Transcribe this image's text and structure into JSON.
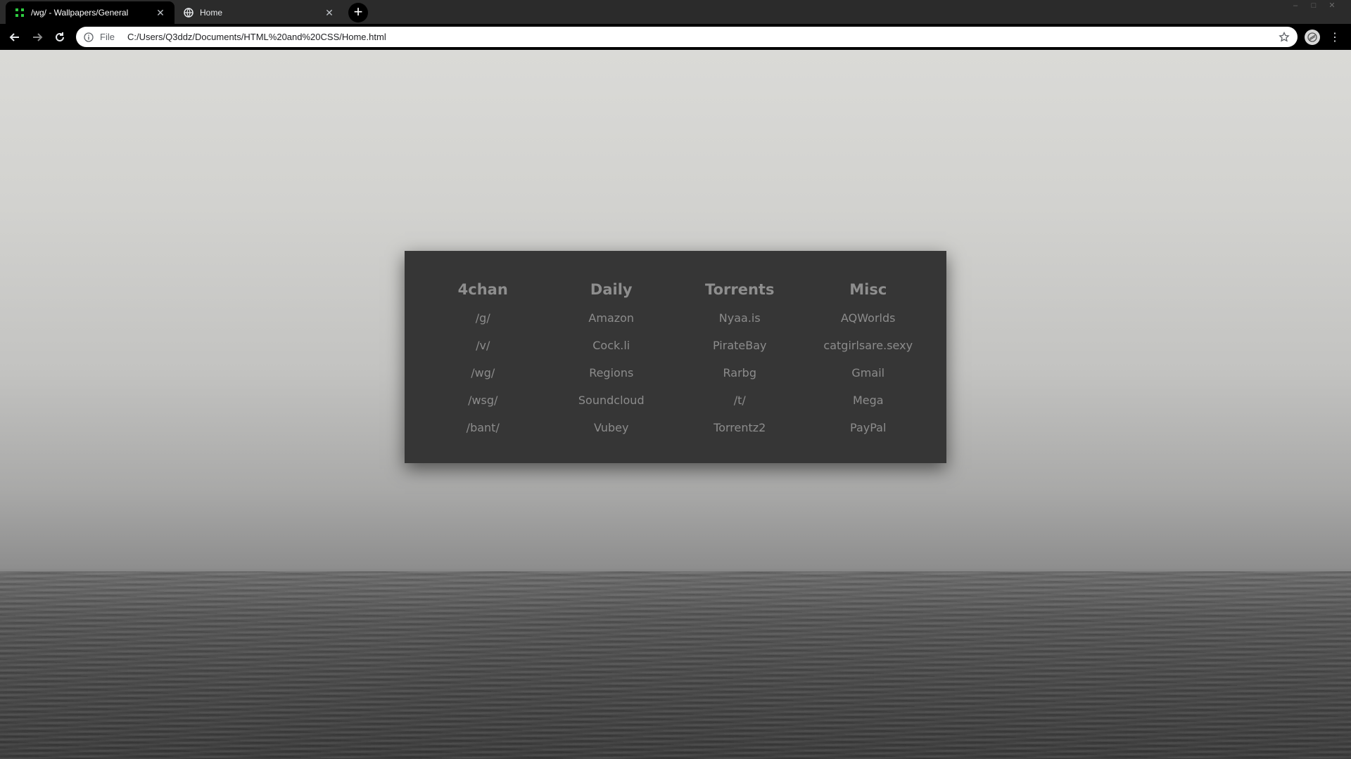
{
  "browser": {
    "tabs": [
      {
        "title": "/wg/ - Wallpapers/General",
        "active": true
      },
      {
        "title": "Home",
        "active": false
      }
    ],
    "new_tab": "+",
    "window_controls": [
      "–",
      "□",
      "✕"
    ],
    "address": {
      "scheme": "File",
      "url": "C:/Users/Q3ddz/Documents/HTML%20and%20CSS/Home.html"
    }
  },
  "panel": {
    "columns": [
      {
        "title": "4chan",
        "links": [
          "/g/",
          "/v/",
          "/wg/",
          "/wsg/",
          "/bant/"
        ]
      },
      {
        "title": "Daily",
        "links": [
          "Amazon",
          "Cock.li",
          "Regions",
          "Soundcloud",
          "Vubey"
        ]
      },
      {
        "title": "Torrents",
        "links": [
          "Nyaa.is",
          "PirateBay",
          "Rarbg",
          "/t/",
          "Torrentz2"
        ]
      },
      {
        "title": "Misc",
        "links": [
          "AQWorlds",
          "catgirlsare.sexy",
          "Gmail",
          "Mega",
          "PayPal"
        ]
      }
    ]
  },
  "colors": {
    "panel_bg": "#363636",
    "panel_text": "#8c8c8c",
    "favicon_green": "#2ecc40"
  }
}
